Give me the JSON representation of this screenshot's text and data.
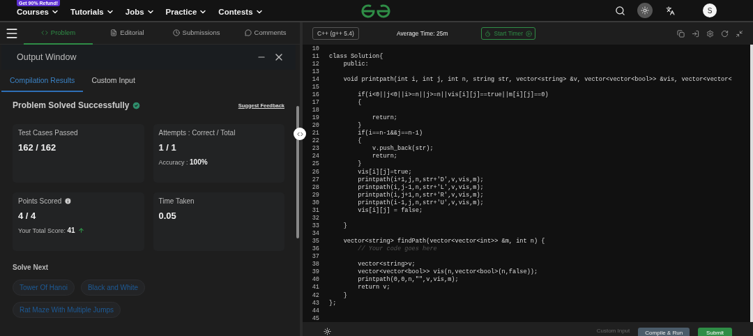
{
  "promo_badge": "Get 90% Refund!",
  "nav": [
    {
      "label": "Courses"
    },
    {
      "label": "Tutorials"
    },
    {
      "label": "Jobs"
    },
    {
      "label": "Practice"
    },
    {
      "label": "Contests"
    }
  ],
  "user": {
    "initial": "S"
  },
  "tabs": [
    {
      "label": "Problem",
      "selected": true
    },
    {
      "label": "Editorial",
      "selected": false
    },
    {
      "label": "Submissions",
      "selected": false
    },
    {
      "label": "Comments",
      "selected": false
    }
  ],
  "output_window": {
    "title": "Output Window",
    "tabs": [
      {
        "label": "Compilation Results",
        "selected": true
      },
      {
        "label": "Custom Input",
        "selected": false
      }
    ],
    "status": "Problem Solved Successfully",
    "feedback_link": "Suggest Feedback",
    "cards": [
      {
        "label": "Test Cases Passed",
        "value": "162 / 162"
      },
      {
        "label": "Attempts : Correct / Total",
        "value": "1 / 1",
        "note_label": "Accuracy : ",
        "note_value": "100%"
      },
      {
        "label": "Points Scored",
        "value": "4 / 4",
        "info": true,
        "note_label": "Your Total Score: ",
        "note_value": "41",
        "trend_up": true
      },
      {
        "label": "Time Taken",
        "value": "0.05"
      }
    ],
    "solve_next_title": "Solve Next",
    "solve_next": [
      "Tower Of Hanoi",
      "Black and White",
      "Rat Maze With Multiple Jumps"
    ]
  },
  "editor": {
    "language": "C++ (g++ 5.4)",
    "average_time": "Average Time: 25m",
    "timer_button": "Start Timer",
    "lines": [
      {
        "n": "10"
      },
      {
        "n": "11",
        "text": "class Solution{"
      },
      {
        "n": "12",
        "text": "    public:"
      },
      {
        "n": "13"
      },
      {
        "n": "14",
        "text": "    void printpath(int i, int j, int n, string str, vector<string> &v, vector<vector<bool>> &vis, vector<vector<"
      },
      {
        "n": "15"
      },
      {
        "n": "16",
        "text": "        if(i<0||j<0||i>=n||j>=n||vis[i][j]==true||m[i][j]==0)"
      },
      {
        "n": "17",
        "text": "        {"
      },
      {
        "n": "18"
      },
      {
        "n": "19",
        "text": "            return;"
      },
      {
        "n": "20",
        "text": "        }"
      },
      {
        "n": "21",
        "text": "        if(i==n-1&&j==n-1)"
      },
      {
        "n": "22",
        "text": "        {"
      },
      {
        "n": "23",
        "text": "            v.push_back(str);"
      },
      {
        "n": "24",
        "text": "            return;"
      },
      {
        "n": "25",
        "text": "        }"
      },
      {
        "n": "26",
        "text": "        vis[i][j]=true;"
      },
      {
        "n": "27",
        "text": "        printpath(i+1,j,n,str+'D',v,vis,m);"
      },
      {
        "n": "28",
        "text": "        printpath(i,j-1,n,str+'L',v,vis,m);"
      },
      {
        "n": "29",
        "text": "        printpath(i,j+1,n,str+'R',v,vis,m);"
      },
      {
        "n": "30",
        "text": "        printpath(i-1,j,n,str+'U',v,vis,m);"
      },
      {
        "n": "31",
        "text": "        vis[i][j] = false;"
      },
      {
        "n": "32"
      },
      {
        "n": "33",
        "text": "    }"
      },
      {
        "n": "34"
      },
      {
        "n": "35",
        "text": "    vector<string> findPath(vector<vector<int>> &m, int n) {"
      },
      {
        "n": "36",
        "text": "        // Your code goes here",
        "kind": "comment"
      },
      {
        "n": "37"
      },
      {
        "n": "38",
        "text": "        vector<string>v;"
      },
      {
        "n": "39",
        "text": "        vector<vector<bool>> vis(n,vector<bool>(n,false));"
      },
      {
        "n": "40",
        "text": "        printpath(0,0,n,\"\",v,vis,m);"
      },
      {
        "n": "41",
        "text": "        return v;"
      },
      {
        "n": "42",
        "text": "    }"
      },
      {
        "n": "43",
        "text": "};"
      },
      {
        "n": "44"
      },
      {
        "n": "45"
      }
    ],
    "footer": {
      "custom_input": "Custom Input",
      "compile": "Compile & Run",
      "submit": "Submit"
    }
  }
}
